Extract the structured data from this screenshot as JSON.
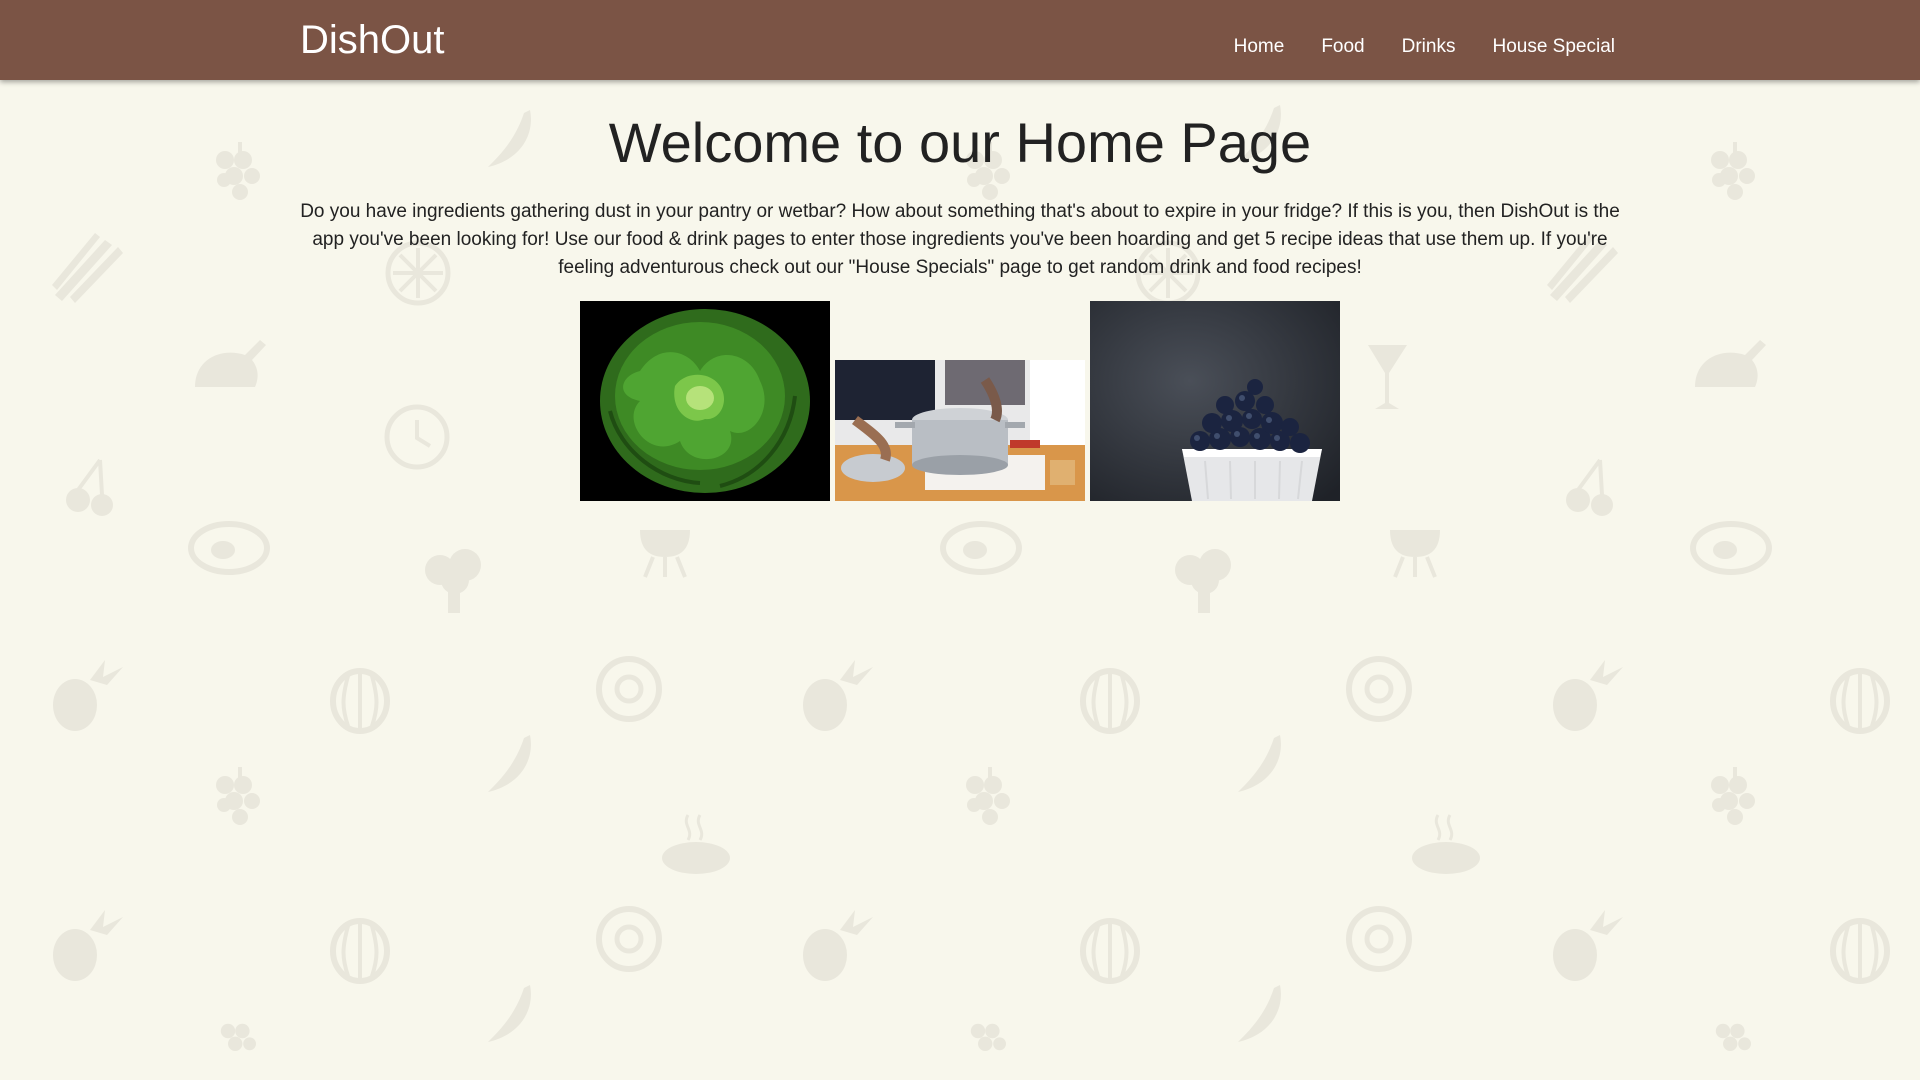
{
  "nav": {
    "brand": "DishOut",
    "links": [
      "Home",
      "Food",
      "Drinks",
      "House Special"
    ]
  },
  "main": {
    "title": "Welcome to our Home Page",
    "intro": "Do you have ingredients gathering dust in your pantry or wetbar? How about something that's about to expire in your fridge? If this is you, then DishOut is the app you've been looking for! Use our food & drink pages to enter those ingredients you've been hoarding and get 5 recipe ideas that use them up. If you're feeling adventurous check out our \"House Specials\" page to get random drink and food recipes!",
    "images": [
      "lettuce-photo",
      "cooking-pot-photo",
      "blueberries-bowl-photo"
    ]
  },
  "colors": {
    "navbar": "#7b5445",
    "background": "#f8f7ec",
    "pattern": "#e9e7dc",
    "text": "#222222"
  }
}
